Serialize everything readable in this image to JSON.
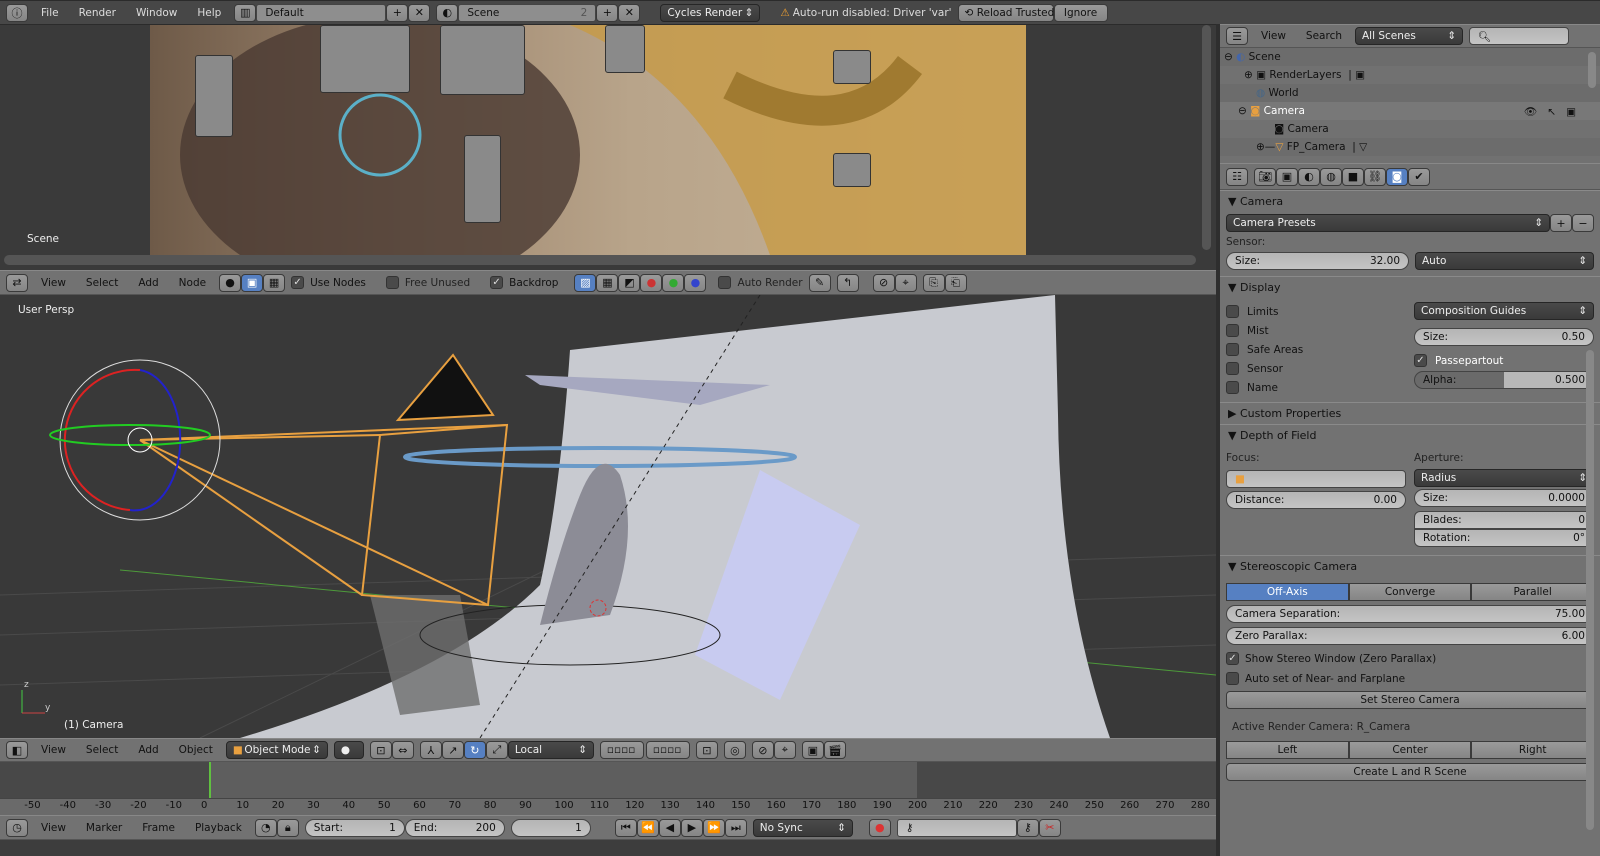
{
  "topbar": {
    "menus": [
      "File",
      "Render",
      "Window",
      "Help"
    ],
    "layout": "Default",
    "scene": "Scene",
    "scene_users": "2",
    "engine": "Cycles Render",
    "warning": "Auto-run disabled: Driver 'var'",
    "reload_trusted": "Reload Trusted",
    "ignore": "Ignore"
  },
  "node_editor": {
    "scene_label": "Scene",
    "menus": [
      "View",
      "Select",
      "Add",
      "Node"
    ],
    "use_nodes": "Use Nodes",
    "free_unused": "Free Unused",
    "backdrop": "Backdrop",
    "auto_render": "Auto Render"
  },
  "viewport": {
    "view_label": "User Persp",
    "object_label": "(1) Camera",
    "menus": [
      "View",
      "Select",
      "Add",
      "Object"
    ],
    "mode": "Object Mode",
    "orientation": "Local",
    "axis_z": "z",
    "axis_y": "y"
  },
  "timeline": {
    "ticks": [
      "-50",
      "-40",
      "-30",
      "-20",
      "-10",
      "0",
      "10",
      "20",
      "30",
      "40",
      "50",
      "60",
      "70",
      "80",
      "90",
      "100",
      "110",
      "120",
      "130",
      "140",
      "150",
      "160",
      "170",
      "180",
      "190",
      "200",
      "210",
      "220",
      "230",
      "240",
      "250",
      "260",
      "270",
      "280"
    ],
    "menus": [
      "View",
      "Marker",
      "Frame",
      "Playback"
    ],
    "start_label": "Start:",
    "start": "1",
    "end_label": "End:",
    "end": "200",
    "current": "1",
    "sync": "No Sync"
  },
  "outliner": {
    "menus": [
      "View",
      "Search"
    ],
    "filter": "All Scenes",
    "items": [
      {
        "label": "Scene"
      },
      {
        "label": "RenderLayers"
      },
      {
        "label": "World"
      },
      {
        "label": "Camera"
      },
      {
        "label": "Camera"
      },
      {
        "label": "FP_Camera"
      }
    ]
  },
  "properties": {
    "camera": {
      "title": "Camera",
      "presets": "Camera Presets",
      "sensor_label": "Sensor:",
      "size_label": "Size:",
      "size": "32.00",
      "fit": "Auto"
    },
    "display": {
      "title": "Display",
      "checks": [
        "Limits",
        "Mist",
        "Safe Areas",
        "Sensor",
        "Name"
      ],
      "guides": "Composition Guides",
      "size_label": "Size:",
      "size": "0.50",
      "passepartout": "Passepartout",
      "alpha_label": "Alpha:",
      "alpha": "0.500",
      "alpha_fraction": 0.5
    },
    "custom": {
      "title": "Custom Properties"
    },
    "dof": {
      "title": "Depth of Field",
      "focus_label": "Focus:",
      "aperture_label": "Aperture:",
      "distance_label": "Distance:",
      "distance": "0.00",
      "aperture_type": "Radius",
      "size_label": "Size:",
      "size": "0.0000",
      "blades_label": "Blades:",
      "blades": "0",
      "rotation_label": "Rotation:",
      "rotation": "0°"
    },
    "stereo": {
      "title": "Stereoscopic Camera",
      "modes": [
        "Off-Axis",
        "Converge",
        "Parallel"
      ],
      "separation_label": "Camera Separation:",
      "separation": "75.00",
      "parallax_label": "Zero Parallax:",
      "parallax": "6.00",
      "show_window": "Show Stereo Window (Zero Parallax)",
      "auto_set": "Auto set of Near- and Farplane",
      "set_button": "Set Stereo Camera",
      "active_label": "Active Render Camera: R_Camera",
      "lcr": [
        "Left",
        "Center",
        "Right"
      ],
      "create": "Create L and R Scene"
    }
  }
}
